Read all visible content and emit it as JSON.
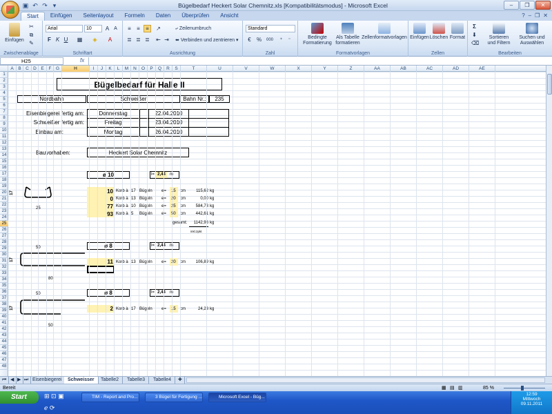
{
  "window": {
    "title": "Bügelbedarf Heckert Solar Chemnitz.xls  [Kompatibilitätsmodus] - Microsoft Excel"
  },
  "qat": {
    "save_icon": "save-icon",
    "undo_icon": "undo-icon",
    "redo_icon": "redo-icon"
  },
  "tabs": [
    "Start",
    "Einfügen",
    "Seitenlayout",
    "Formeln",
    "Daten",
    "Überprüfen",
    "Ansicht"
  ],
  "ribbon": {
    "clipboard": {
      "paste": "Einfügen",
      "label": "Zwischenablage"
    },
    "font": {
      "name": "Arial",
      "size": "10",
      "label": "Schriftart",
      "bold": "F",
      "italic": "K",
      "underline": "U"
    },
    "alignment": {
      "wrap": "Zeilenumbruch",
      "merge": "Verbinden und zentrieren",
      "label": "Ausrichtung"
    },
    "number": {
      "format": "Standard",
      "label": "Zahl",
      "percent": "%",
      "thousands": "000"
    },
    "styles": {
      "conditional": [
        "Bedingte",
        "Formatierung"
      ],
      "table": [
        "Als Tabelle",
        "formatieren"
      ],
      "cell": "Zellenformatvorlagen",
      "label": "Formatvorlagen"
    },
    "cells": {
      "insert": "Einfügen",
      "delete": "Löschen",
      "format": "Format",
      "label": "Zellen"
    },
    "editing": {
      "sort": [
        "Sortieren",
        "und Filtern"
      ],
      "find": [
        "Suchen und",
        "Auswählen"
      ],
      "label": "Bearbeiten",
      "sigma": "Σ"
    }
  },
  "formula_bar": {
    "name_box": "H25",
    "fx": "fx",
    "content": ""
  },
  "columns": [
    "A",
    "B",
    "C",
    "D",
    "E",
    "F",
    "G",
    "H",
    "I",
    "J",
    "K",
    "L",
    "M",
    "N",
    "O",
    "P",
    "Q",
    "R",
    "S",
    "T",
    "U",
    "V",
    "W",
    "X",
    "Y",
    "Z",
    "AA",
    "AB",
    "AC",
    "AD",
    "AE"
  ],
  "rows": [
    "1",
    "2",
    "3",
    "4",
    "5",
    "6",
    "7",
    "8",
    "9",
    "10",
    "11",
    "12",
    "13",
    "14",
    "15",
    "16",
    "17",
    "18",
    "19",
    "20",
    "21",
    "22",
    "23",
    "24",
    "25",
    "26",
    "27",
    "28",
    "29",
    "30",
    "31",
    "32",
    "33",
    "34",
    "35",
    "36",
    "37",
    "38",
    "39",
    "40",
    "41",
    "42",
    "43",
    "44",
    "45",
    "46",
    "47",
    "48"
  ],
  "sheet": {
    "title": "Bügelbedarf für Halle II",
    "nordbahn": "Nordbahn",
    "schweisser": "Schweißer",
    "bahn_label": "Bahn Nr.:",
    "bahn_nr": "235",
    "schedule": [
      {
        "label": "Eisenbiegerei fertig am:",
        "day": "Donnerstag",
        "date": "22.04.2010"
      },
      {
        "label": "Schweißer fertig am:",
        "day": "Freitag",
        "date": "23.04.2010"
      },
      {
        "label": "Einbau am:",
        "day": "Montag",
        "date": "26.04.2010"
      }
    ],
    "bauvorhaben_label": "Bauvorhaben:",
    "bauvorhaben": "Heckert Solar Chemnitz",
    "block1": {
      "diameter": "ø 10",
      "l_label": "l=",
      "l_value": "2,44",
      "l_unit": "m",
      "side_label": "17",
      "bottom_label": "25",
      "rows": [
        {
          "qty": "10",
          "korb": "Korb à",
          "n": "17",
          "buegeln": "Bügeln",
          "e": "e=",
          "spacing": "15",
          "cm": "cm",
          "weight": "115,62",
          "kg": "kg"
        },
        {
          "qty": "0",
          "korb": "Korb à",
          "n": "13",
          "buegeln": "Bügeln",
          "e": "e=",
          "spacing": "20",
          "cm": "cm",
          "weight": "0,00",
          "kg": "kg"
        },
        {
          "qty": "77",
          "korb": "Korb à",
          "n": "10",
          "buegeln": "Bügeln",
          "e": "e=",
          "spacing": "25",
          "cm": "cm",
          "weight": "584,73",
          "kg": "kg"
        },
        {
          "qty": "93",
          "korb": "Korb à",
          "n": "5",
          "buegeln": "Bügeln",
          "e": "e=",
          "spacing": "50",
          "cm": "cm",
          "weight": "442,61",
          "kg": "kg"
        }
      ],
      "total_label": "gesamt:",
      "total": "1142,96",
      "total_unit": "kg",
      "note": "inkl.2pkt"
    },
    "block2": {
      "diameter": "ø 8",
      "l_label": "l=",
      "l_value": "2,44",
      "l_unit": "m",
      "top_label": "50",
      "side_label": "17",
      "bottom_label": "80",
      "row": {
        "qty": "11",
        "korb": "Korb à",
        "n": "13",
        "buegeln": "Bügeln",
        "e": "e=",
        "spacing": "20",
        "cm": "cm",
        "weight": "106,89",
        "kg": "kg"
      }
    },
    "block3": {
      "diameter": "ø 8",
      "l_label": "l=",
      "l_value": "2,44",
      "l_unit": "m",
      "top_label": "50",
      "side_label": "17",
      "bottom_label": "50",
      "row": {
        "qty": "2",
        "korb": "Korb à",
        "n": "17",
        "buegeln": "Bügeln",
        "e": "e=",
        "spacing": "15",
        "cm": "cm",
        "weight": "24,23",
        "kg": "kg"
      }
    }
  },
  "sheet_tabs": [
    "Eisenbiegerei",
    "Schweisser",
    "Tabelle2",
    "Tabelle3",
    "Tabelle4"
  ],
  "status": {
    "ready": "Bereit",
    "zoom": "85 %"
  },
  "taskbar": {
    "start": "Start",
    "tasks": [
      "TIM - Report and Pro...",
      "3 Bügel für Fertigung ...",
      "Microsoft Excel - Büg..."
    ],
    "time": "12:59",
    "day": "Mittwoch",
    "date": "09.11.2011"
  }
}
